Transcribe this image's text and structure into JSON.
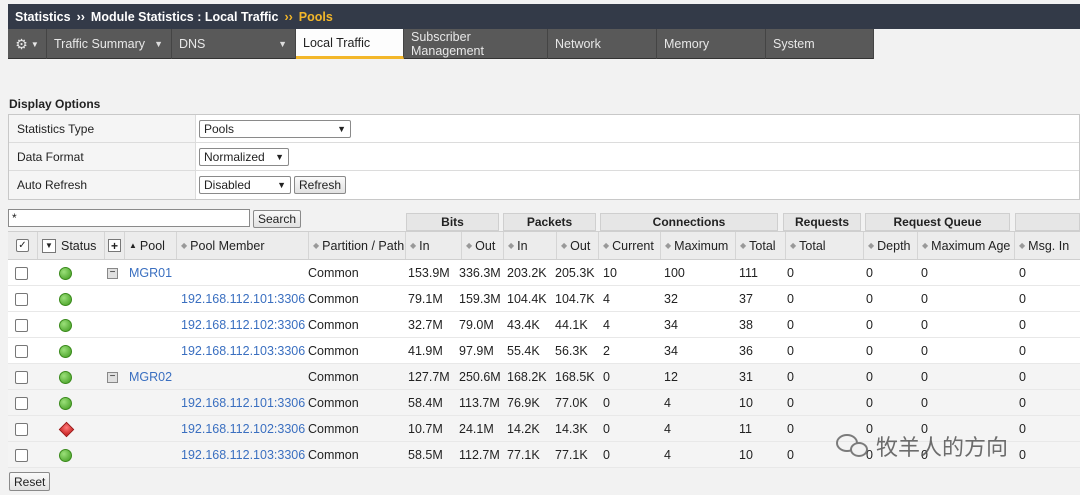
{
  "breadcrumb": {
    "part1": "Statistics",
    "sep1": "››",
    "part2": "Module Statistics : Local Traffic",
    "sep2": "››",
    "current": "Pools"
  },
  "tabs": [
    {
      "label": "Traffic Summary",
      "dropdown": true
    },
    {
      "label": "DNS",
      "dropdown": true
    },
    {
      "label": "Local Traffic",
      "dropdown": false,
      "active": true
    },
    {
      "label": "Subscriber Management",
      "dropdown": false
    },
    {
      "label": "Network",
      "dropdown": false
    },
    {
      "label": "Memory",
      "dropdown": false
    },
    {
      "label": "System",
      "dropdown": false
    }
  ],
  "display_options": {
    "title": "Display Options",
    "stats_type_label": "Statistics Type",
    "stats_type_value": "Pools",
    "data_format_label": "Data Format",
    "data_format_value": "Normalized",
    "auto_refresh_label": "Auto Refresh",
    "auto_refresh_value": "Disabled",
    "refresh_button": "Refresh"
  },
  "search": {
    "value": "*",
    "button": "Search"
  },
  "groups": {
    "bits": "Bits",
    "packets": "Packets",
    "connections": "Connections",
    "requests": "Requests",
    "request_queue": "Request Queue"
  },
  "columns": {
    "status": "Status",
    "pool": "Pool",
    "pool_member": "Pool Member",
    "partition": "Partition / Path",
    "bits_in": "In",
    "bits_out": "Out",
    "pk_in": "In",
    "pk_out": "Out",
    "current": "Current",
    "maximum": "Maximum",
    "total": "Total",
    "req_total": "Total",
    "depth": "Depth",
    "max_age": "Maximum Age",
    "msg_in": "Msg. In"
  },
  "rows": [
    {
      "status": "green",
      "pool": "MGR01",
      "member": "",
      "partition": "Common",
      "bits_in": "153.9M",
      "bits_out": "336.3M",
      "pk_in": "203.2K",
      "pk_out": "205.3K",
      "current": "10",
      "maximum": "100",
      "total": "111",
      "req_total": "0",
      "depth": "0",
      "max_age": "0",
      "msg_in": "0"
    },
    {
      "status": "green",
      "pool": "",
      "member": "192.168.112.101:3306",
      "partition": "Common",
      "bits_in": "79.1M",
      "bits_out": "159.3M",
      "pk_in": "104.4K",
      "pk_out": "104.7K",
      "current": "4",
      "maximum": "32",
      "total": "37",
      "req_total": "0",
      "depth": "0",
      "max_age": "0",
      "msg_in": "0"
    },
    {
      "status": "green",
      "pool": "",
      "member": "192.168.112.102:3306",
      "partition": "Common",
      "bits_in": "32.7M",
      "bits_out": "79.0M",
      "pk_in": "43.4K",
      "pk_out": "44.1K",
      "current": "4",
      "maximum": "34",
      "total": "38",
      "req_total": "0",
      "depth": "0",
      "max_age": "0",
      "msg_in": "0"
    },
    {
      "status": "green",
      "pool": "",
      "member": "192.168.112.103:3306",
      "partition": "Common",
      "bits_in": "41.9M",
      "bits_out": "97.9M",
      "pk_in": "55.4K",
      "pk_out": "56.3K",
      "current": "2",
      "maximum": "34",
      "total": "36",
      "req_total": "0",
      "depth": "0",
      "max_age": "0",
      "msg_in": "0"
    },
    {
      "status": "green",
      "pool": "MGR02",
      "member": "",
      "partition": "Common",
      "bits_in": "127.7M",
      "bits_out": "250.6M",
      "pk_in": "168.2K",
      "pk_out": "168.5K",
      "current": "0",
      "maximum": "12",
      "total": "31",
      "req_total": "0",
      "depth": "0",
      "max_age": "0",
      "msg_in": "0"
    },
    {
      "status": "green",
      "pool": "",
      "member": "192.168.112.101:3306",
      "partition": "Common",
      "bits_in": "58.4M",
      "bits_out": "113.7M",
      "pk_in": "76.9K",
      "pk_out": "77.0K",
      "current": "0",
      "maximum": "4",
      "total": "10",
      "req_total": "0",
      "depth": "0",
      "max_age": "0",
      "msg_in": "0"
    },
    {
      "status": "red",
      "pool": "",
      "member": "192.168.112.102:3306",
      "partition": "Common",
      "bits_in": "10.7M",
      "bits_out": "24.1M",
      "pk_in": "14.2K",
      "pk_out": "14.3K",
      "current": "0",
      "maximum": "4",
      "total": "11",
      "req_total": "0",
      "depth": "0",
      "max_age": "0",
      "msg_in": "0"
    },
    {
      "status": "green",
      "pool": "",
      "member": "192.168.112.103:3306",
      "partition": "Common",
      "bits_in": "58.5M",
      "bits_out": "112.7M",
      "pk_in": "77.1K",
      "pk_out": "77.1K",
      "current": "0",
      "maximum": "4",
      "total": "10",
      "req_total": "0",
      "depth": "0",
      "max_age": "0",
      "msg_in": "0"
    }
  ],
  "reset_button": "Reset",
  "watermark": "牧羊人的方向",
  "colors": {
    "title_bg": "#333a48",
    "accent": "#f3b72a",
    "link": "#3a6fc0",
    "up": "#3f9a1e",
    "down": "#c41616"
  }
}
